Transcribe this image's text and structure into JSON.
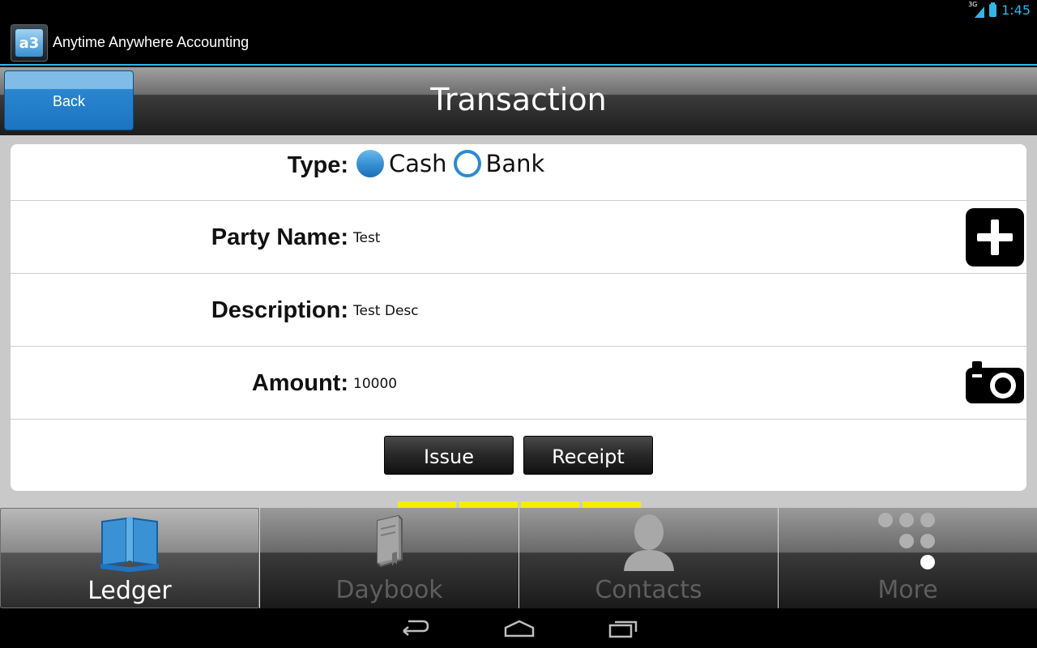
{
  "status_bar": {
    "network": "3G",
    "time": "1:45"
  },
  "app": {
    "title": "Anytime Anywhere Accounting",
    "logo_text": "a3"
  },
  "header": {
    "back_label": "Back",
    "title": "Transaction"
  },
  "form": {
    "type_label": "Type:",
    "type_options": [
      {
        "label": "Cash",
        "selected": true
      },
      {
        "label": "Bank",
        "selected": false
      }
    ],
    "party_name_label": "Party Name:",
    "party_name_value": "Test",
    "description_label": "Description:",
    "description_value": "Test Desc",
    "amount_label": "Amount:",
    "amount_value": "10000",
    "issue_label": "Issue",
    "receipt_label": "Receipt"
  },
  "tabs": [
    {
      "label": "Ledger",
      "icon": "book-icon",
      "active": true
    },
    {
      "label": "Daybook",
      "icon": "daybook-icon",
      "active": false
    },
    {
      "label": "Contacts",
      "icon": "person-icon",
      "active": false
    },
    {
      "label": "More",
      "icon": "dots-icon",
      "active": false
    }
  ],
  "colors": {
    "accent": "#33b5e5",
    "button_blue": "#1c74c2",
    "marker_yellow": "#f5ee00"
  }
}
